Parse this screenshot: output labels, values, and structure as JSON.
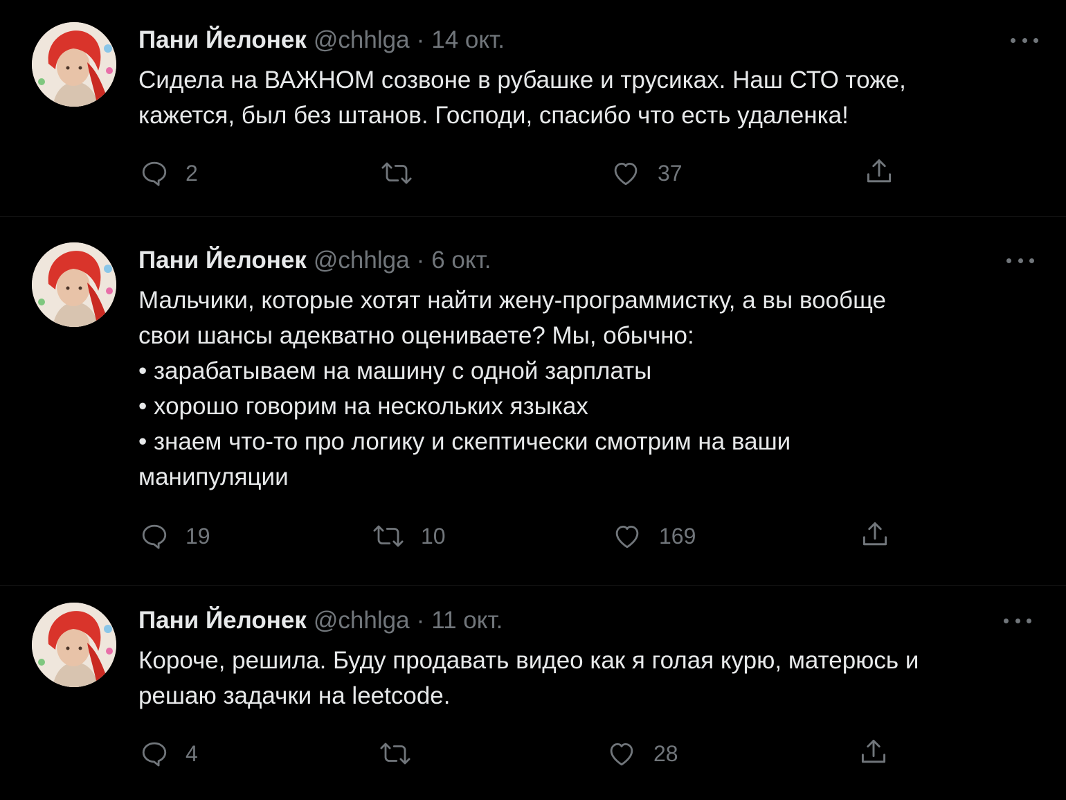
{
  "tweets": [
    {
      "author_name": "Пани Йелонек",
      "handle": "@chhlga",
      "separator": "·",
      "date": "14 окт.",
      "text_lines": [
        "Сидела на ВАЖНОМ созвоне в рубашке и трусиках. Наш СТО тоже,",
        "кажется, был без штанов. Господи, спасибо что есть удаленка!"
      ],
      "replies": "2",
      "retweets": "",
      "likes": "37"
    },
    {
      "author_name": "Пани Йелонек",
      "handle": "@chhlga",
      "separator": "·",
      "date": "6 окт.",
      "text_lines": [
        "Мальчики, которые хотят найти жену-программистку, а вы вообще",
        "свои шансы адекватно оцениваете? Мы, обычно:",
        "• зарабатываем на машину с одной зарплаты",
        "• хорошо говорим на нескольких языках",
        "• знаем что-то про логику и скептически смотрим на ваши",
        "манипуляции"
      ],
      "replies": "19",
      "retweets": "10",
      "likes": "169"
    },
    {
      "author_name": "Пани Йелонек",
      "handle": "@chhlga",
      "separator": "·",
      "date": "11 окт.",
      "text_lines": [
        "Короче, решила. Буду продавать видео как я голая курю, матерюсь и",
        "решаю задачки на leetcode."
      ],
      "replies": "4",
      "retweets": "",
      "likes": "28"
    }
  ],
  "icons": {
    "avatar": "avatar-photo",
    "more": "more-options-icon",
    "reply": "reply-icon",
    "retweet": "retweet-icon",
    "like": "like-icon",
    "share": "share-icon"
  },
  "colors": {
    "background": "#000000",
    "text": "#e7e9ea",
    "secondary": "#71767b",
    "avatar_hair": "#d9342b"
  }
}
